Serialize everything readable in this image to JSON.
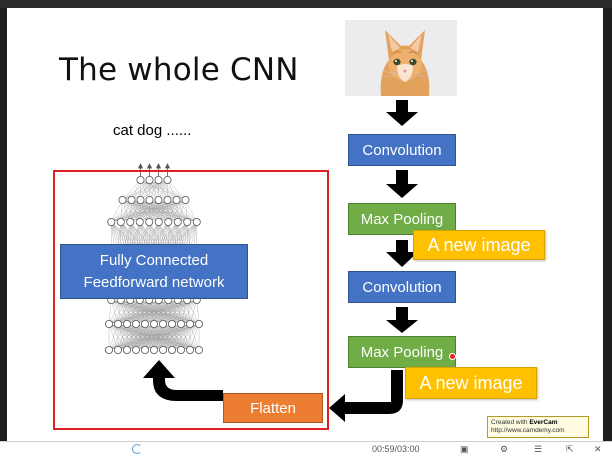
{
  "slide": {
    "title": "The whole CNN",
    "output_label": "cat dog ......",
    "fc_label_line1": "Fully Connected",
    "fc_label_line2": "Feedforward network",
    "steps": {
      "conv1": "Convolution",
      "maxpool1": "Max Pooling",
      "conv2": "Convolution",
      "maxpool2": "Max Pooling",
      "flatten": "Flatten"
    },
    "callouts": {
      "new_image_1": "A new image",
      "new_image_2": "A new image"
    },
    "watermark": {
      "line1_prefix": "Created with",
      "line1_brand": "EverCam",
      "line2": "http://www.camdemy.com"
    }
  },
  "statusbar": {
    "time_text": "00:59/03:00"
  },
  "colors": {
    "blue": "#4472c4",
    "green": "#70ad47",
    "yellow": "#ffc000",
    "orange": "#ed7d31",
    "red_frame": "#e02020"
  }
}
